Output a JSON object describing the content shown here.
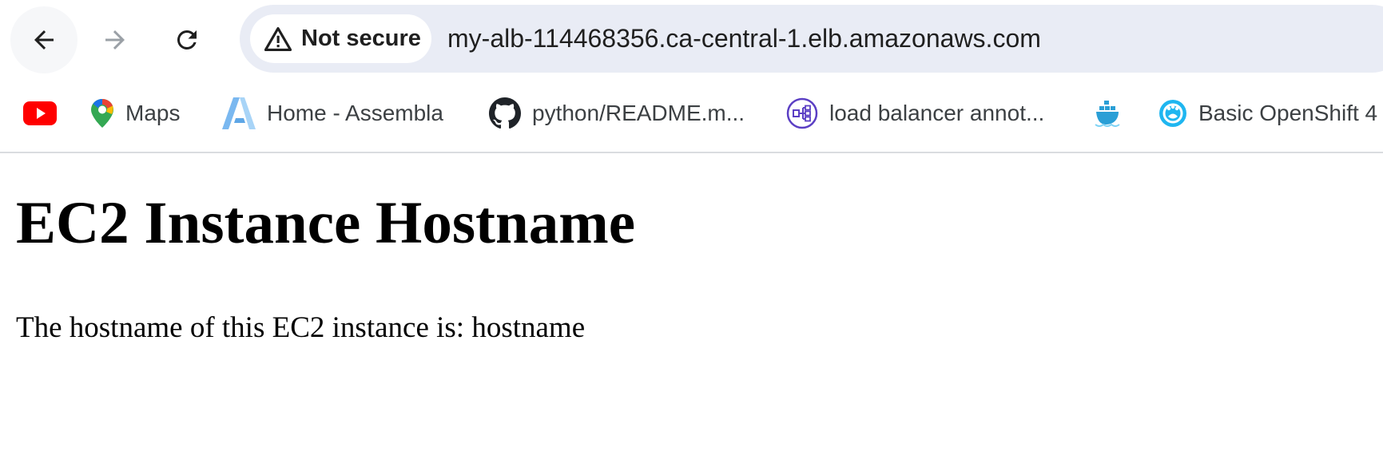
{
  "browser": {
    "security_chip": {
      "icon": "warning-triangle-icon",
      "label": "Not secure"
    },
    "url": "my-alb-114468356.ca-central-1.elb.amazonaws.com",
    "nav": {
      "back_icon": "arrow-left-icon",
      "forward_icon": "arrow-right-icon",
      "reload_icon": "reload-icon"
    }
  },
  "bookmarks": [
    {
      "icon": "youtube-icon",
      "label": ""
    },
    {
      "icon": "google-maps-icon",
      "label": "Maps"
    },
    {
      "icon": "assembla-icon",
      "label": "Home - Assembla"
    },
    {
      "icon": "github-icon",
      "label": "python/README.m..."
    },
    {
      "icon": "load-balancer-icon",
      "label": "load balancer annot..."
    },
    {
      "icon": "docker-icon",
      "label": ""
    },
    {
      "icon": "openshift-icon",
      "label": "Basic OpenShift 4"
    }
  ],
  "page": {
    "heading": "EC2 Instance Hostname",
    "body": "The hostname of this EC2 instance is: hostname"
  },
  "colors": {
    "omnibox_bg": "#e9ecf5",
    "youtube_red": "#ff0000",
    "assembla_blue": "#7ab8f0",
    "lb_purple": "#5b3fc4",
    "openshift_cyan": "#1fb6f0"
  }
}
